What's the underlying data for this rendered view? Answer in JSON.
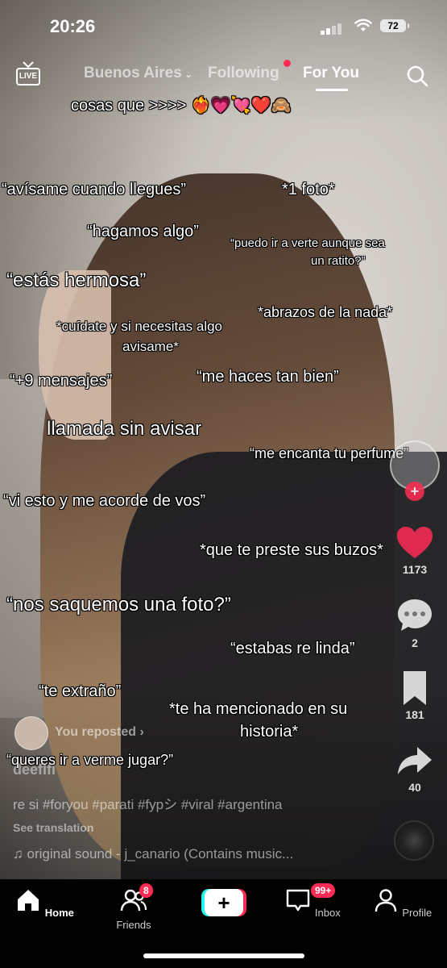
{
  "status": {
    "time": "20:26",
    "battery": "72"
  },
  "topnav": {
    "live_label": "LIVE",
    "tabs": [
      "Buenos Aires",
      "Following",
      "For You"
    ],
    "active_tab": "For You"
  },
  "captions": [
    "cosas que >>>> ❤️‍🔥💗💘❤️🙈",
    "“avísame cuando llegues”",
    "*1 foto*",
    "“hagamos algo”",
    "“puedo ir a verte aunque sea",
    "un ratito?”",
    "“estás hermosa”",
    "*abrazos de la nada*",
    "*cuídate y si necesitas algo",
    "avisame*",
    "“+9 mensajes”",
    "“me haces tan bien”",
    "llamada sin avisar",
    "“me encanta tu perfume”",
    "“vi esto y me acorde de vos”",
    "*que te preste sus buzos*",
    "“nos saquemos una foto?”",
    "“estabas re linda”",
    "“te extraño”",
    "*te ha mencionado en su",
    "historia*",
    "“queres ir a verme jugar?”"
  ],
  "rail": {
    "likes": "1173",
    "comments": "2",
    "saves": "181",
    "shares": "40"
  },
  "meta": {
    "reposted": "You reposted",
    "username": "deeflfi",
    "description": "re si #foryou #parati #fypシ #viral #argentina",
    "see_translation": "See translation",
    "sound": "original sound - j_canario (Contains music..."
  },
  "bottom_nav": {
    "home": "Home",
    "friends": "Friends",
    "friends_badge": "8",
    "inbox": "Inbox",
    "inbox_badge": "99+",
    "profile": "Profile"
  },
  "colors": {
    "accent": "#fe2c55",
    "cyan": "#25f4ee"
  }
}
